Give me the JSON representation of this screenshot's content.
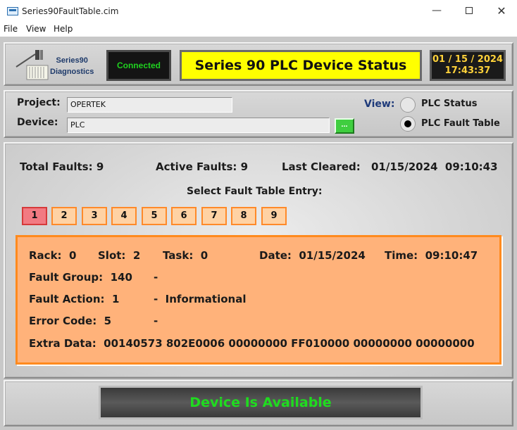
{
  "window": {
    "title": "Series90FaultTable.cim",
    "minimize_glyph": "—",
    "close_glyph": "✕"
  },
  "menu": {
    "items": [
      "File",
      "View",
      "Help"
    ]
  },
  "header": {
    "logo_line1": "Series90",
    "logo_line2": "Diagnostics",
    "connection_status": "Connected",
    "title": "Series 90 PLC Device Status",
    "date": "01 / 15 / 2024",
    "time": "17:43:37"
  },
  "info": {
    "project_label": "Project:",
    "project_value": "OPERTEK",
    "device_label": "Device:",
    "device_value": "PLC",
    "browse_label": "...",
    "view_label": "View:",
    "view_options": [
      {
        "label": "PLC Status",
        "selected": false
      },
      {
        "label": "PLC Fault Table",
        "selected": true
      }
    ]
  },
  "stats": {
    "total_faults": "Total Faults: 9",
    "active_faults": "Active Faults: 9",
    "last_cleared_label": "Last Cleared:",
    "last_cleared_value": "01/15/2024  09:10:43"
  },
  "fault_table": {
    "select_label": "Select Fault Table Entry:",
    "entries": [
      "1",
      "2",
      "3",
      "4",
      "5",
      "6",
      "7",
      "8",
      "9"
    ],
    "selected_entry": "1"
  },
  "fault_detail": {
    "rack": "Rack:  0",
    "slot": "Slot:  2",
    "task": "Task:  0",
    "date": "Date:  01/15/2024",
    "time": "Time:  09:10:47",
    "fault_group": "Fault Group:  140",
    "fault_group_desc": "-",
    "fault_action": "Fault Action:  1",
    "fault_action_desc": "-  Informational",
    "error_code": "Error Code:  5",
    "error_code_desc": "-",
    "extra_data": "Extra Data:  00140573 802E0006 00000000 FF010000 00000000 00000000"
  },
  "status_bar": {
    "message": "Device Is Available"
  },
  "colors": {
    "title_bg": "#ffff00",
    "clock_text": "#ffd23a",
    "connected_text": "#1fd11f",
    "fault_box_bg": "#ffb27a",
    "fault_box_border": "#ff8a1e",
    "selected_entry_bg": "#f27a82",
    "available_text": "#1fdc1f"
  }
}
